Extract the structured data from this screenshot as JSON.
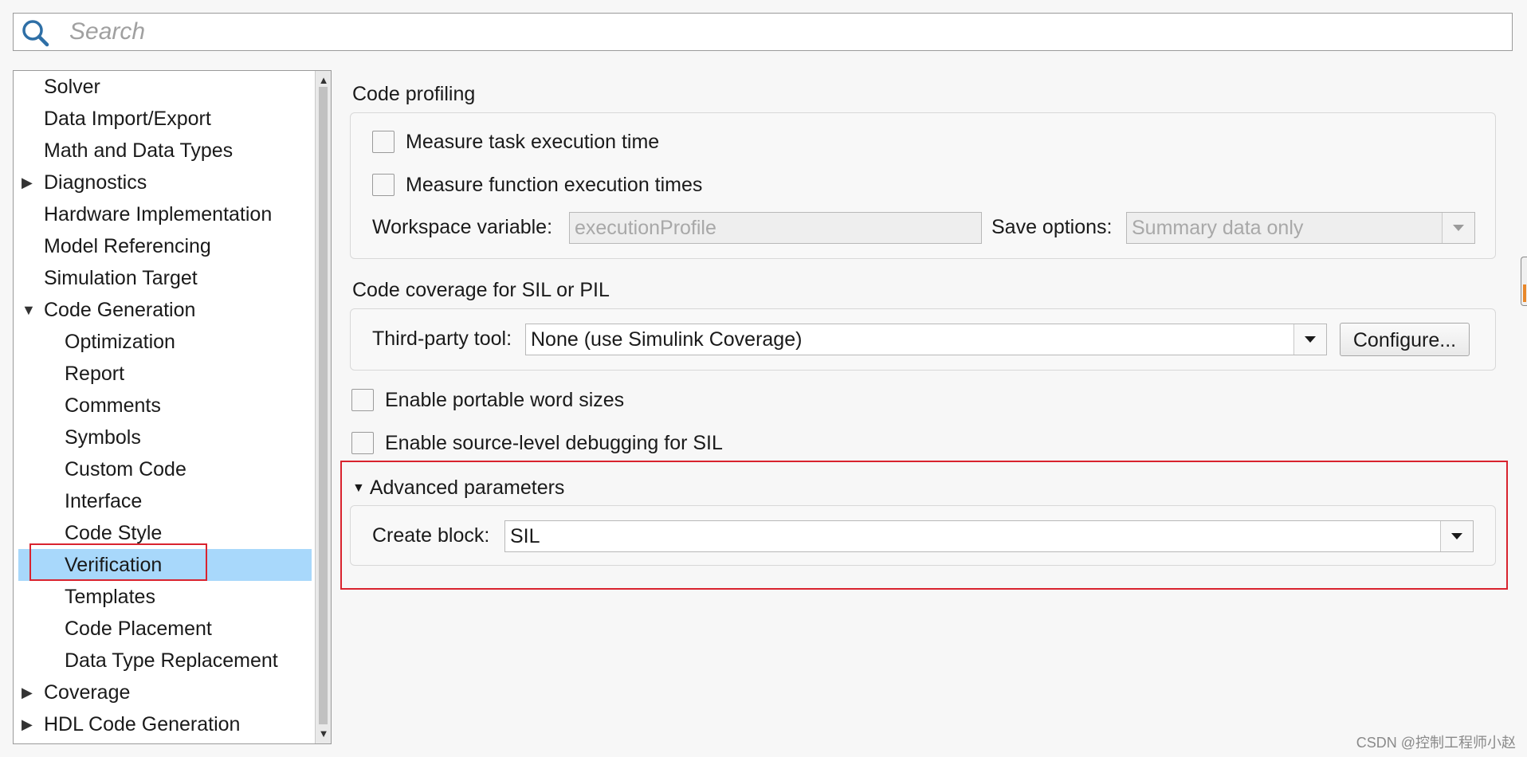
{
  "search": {
    "placeholder": "Search"
  },
  "tree": {
    "items": [
      {
        "label": "Solver",
        "expander": ""
      },
      {
        "label": "Data Import/Export",
        "expander": ""
      },
      {
        "label": "Math and Data Types",
        "expander": ""
      },
      {
        "label": "Diagnostics",
        "expander": "collapsed"
      },
      {
        "label": "Hardware Implementation",
        "expander": ""
      },
      {
        "label": "Model Referencing",
        "expander": ""
      },
      {
        "label": "Simulation Target",
        "expander": ""
      },
      {
        "label": "Code Generation",
        "expander": "expanded"
      },
      {
        "label": "Optimization",
        "expander": ""
      },
      {
        "label": "Report",
        "expander": ""
      },
      {
        "label": "Comments",
        "expander": ""
      },
      {
        "label": "Symbols",
        "expander": ""
      },
      {
        "label": "Custom Code",
        "expander": ""
      },
      {
        "label": "Interface",
        "expander": ""
      },
      {
        "label": "Code Style",
        "expander": ""
      },
      {
        "label": "Verification",
        "expander": "",
        "selected": true
      },
      {
        "label": "Templates",
        "expander": ""
      },
      {
        "label": "Code Placement",
        "expander": ""
      },
      {
        "label": "Data Type Replacement",
        "expander": ""
      },
      {
        "label": "Coverage",
        "expander": "collapsed"
      },
      {
        "label": "HDL Code Generation",
        "expander": "collapsed"
      }
    ]
  },
  "profiling": {
    "title": "Code profiling",
    "measure_task": "Measure task execution time",
    "measure_function": "Measure function execution times",
    "workspace_label": "Workspace variable:",
    "workspace_value": "executionProfile",
    "save_label": "Save options:",
    "save_value": "Summary data only"
  },
  "coverage": {
    "title": "Code coverage for SIL or PIL",
    "tool_label": "Third-party tool:",
    "tool_value": "None (use Simulink Coverage)",
    "configure_label": "Configure..."
  },
  "options": {
    "portable": "Enable portable word sizes",
    "debugging": "Enable source-level debugging for SIL"
  },
  "advanced": {
    "title": "Advanced parameters",
    "create_label": "Create block:",
    "create_value": "SIL"
  },
  "watermark": "CSDN @控制工程师小赵",
  "colors": {
    "selection": "#a8d8fb",
    "highlight": "#d9232e",
    "accent": "#e8872a"
  }
}
